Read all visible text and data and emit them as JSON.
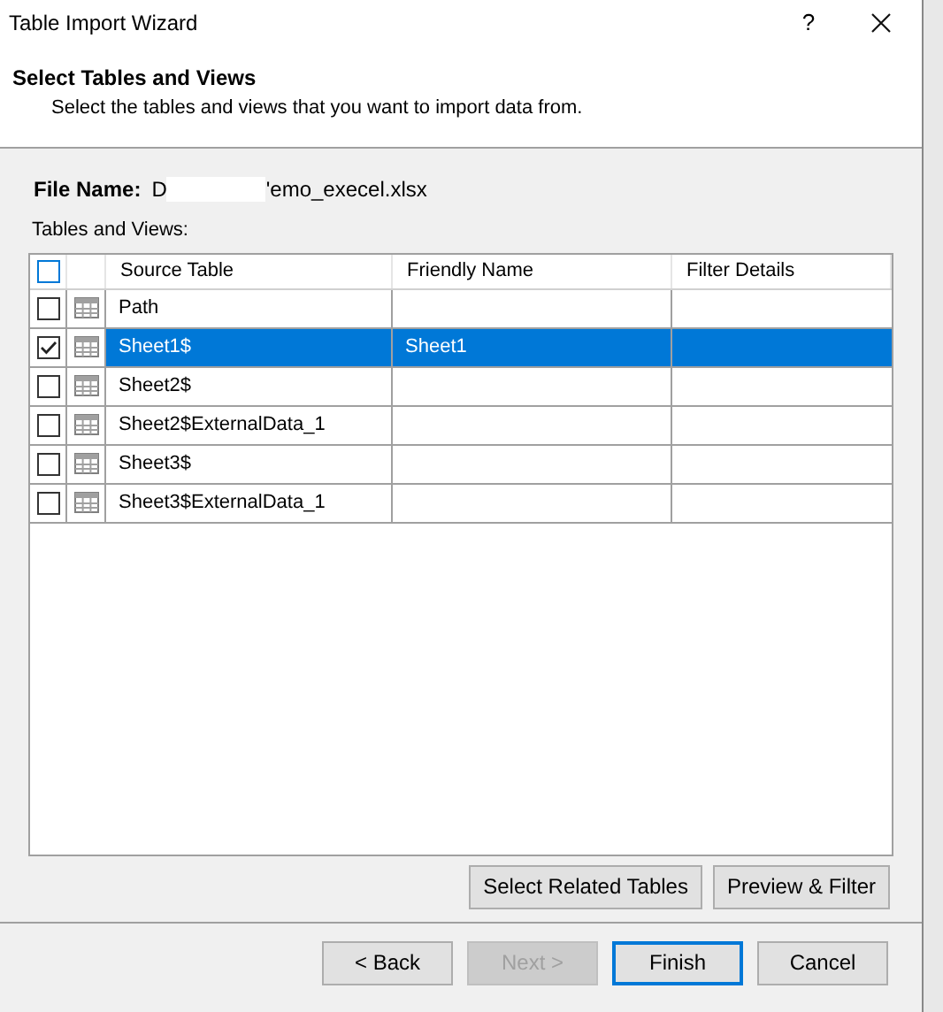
{
  "window": {
    "title": "Table Import Wizard",
    "help": "?"
  },
  "header": {
    "title": "Select Tables and Views",
    "subtitle": "Select the tables and views that you want to import data from."
  },
  "file_name": {
    "label": "File Name:",
    "value_start": "D",
    "value_end": "'emo_execel.xlsx"
  },
  "tables_label": "Tables and Views:",
  "table": {
    "select_all_checked": false,
    "columns": [
      "Source Table",
      "Friendly Name",
      "Filter Details"
    ],
    "rows": [
      {
        "source": "Path",
        "friendly": "",
        "checked": false,
        "selected": false
      },
      {
        "source": "Sheet1$",
        "friendly": "Sheet1",
        "checked": true,
        "selected": true
      },
      {
        "source": "Sheet2$",
        "friendly": "",
        "checked": false,
        "selected": false
      },
      {
        "source": "Sheet2$ExternalData_1",
        "friendly": "",
        "checked": false,
        "selected": false
      },
      {
        "source": "Sheet3$",
        "friendly": "",
        "checked": false,
        "selected": false
      },
      {
        "source": "Sheet3$ExternalData_1",
        "friendly": "",
        "checked": false,
        "selected": false
      }
    ]
  },
  "table_buttons": [
    "Select Related Tables",
    "Preview & Filter"
  ],
  "nav_buttons": [
    {
      "label": "< Back",
      "disabled": false,
      "default": false
    },
    {
      "label": "Next >",
      "disabled": true,
      "default": false
    },
    {
      "label": "Finish",
      "disabled": false,
      "default": true
    },
    {
      "label": "Cancel",
      "disabled": false,
      "default": false
    }
  ]
}
